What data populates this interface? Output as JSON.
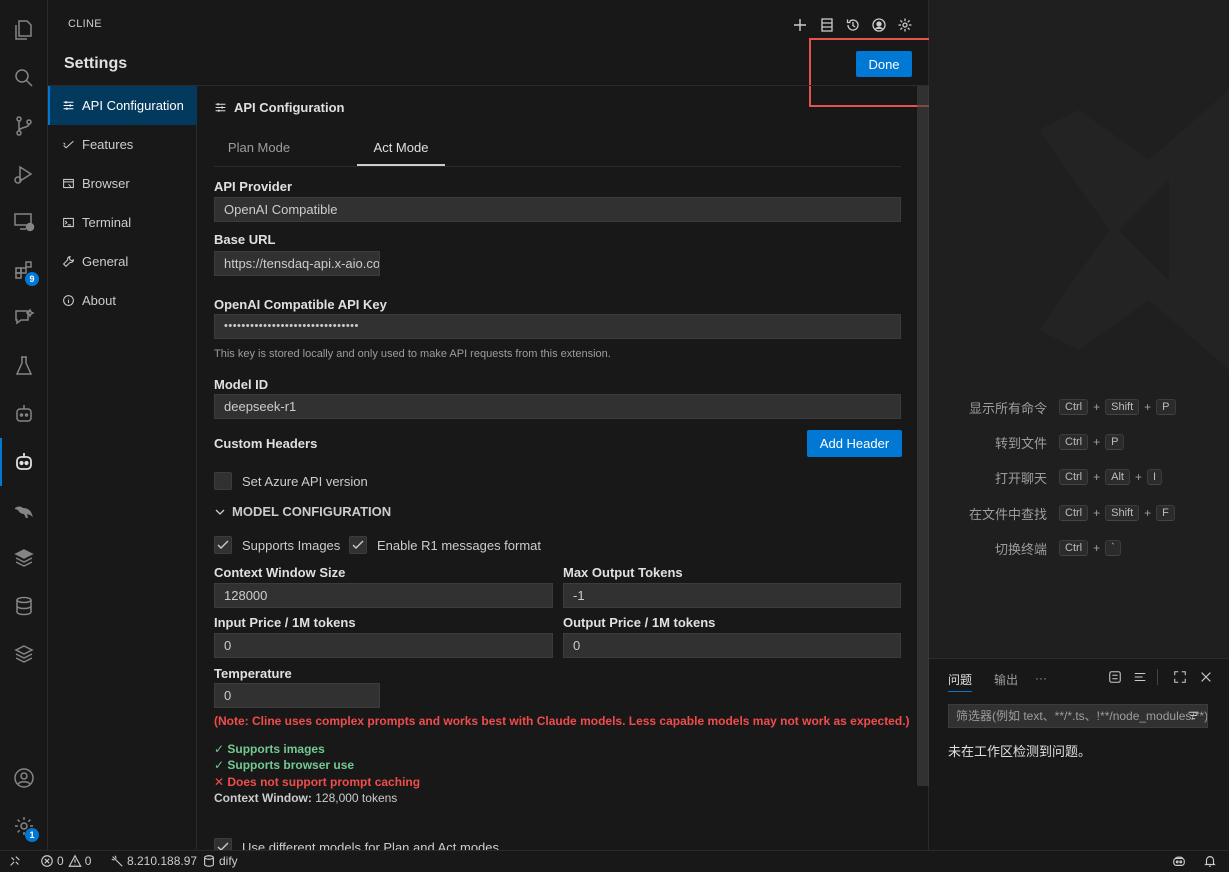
{
  "cline": {
    "title": "CLINE",
    "settings_heading": "Settings",
    "done_label": "Done"
  },
  "sidebar": {
    "items": [
      {
        "label": "API Configuration",
        "icon": "sliders-icon"
      },
      {
        "label": "Features",
        "icon": "check-icon"
      },
      {
        "label": "Browser",
        "icon": "browser-icon"
      },
      {
        "label": "Terminal",
        "icon": "terminal-icon"
      },
      {
        "label": "General",
        "icon": "wrench-icon"
      },
      {
        "label": "About",
        "icon": "info-icon"
      }
    ]
  },
  "api": {
    "section_title": "API Configuration",
    "tabs": [
      "Plan Mode",
      "Act Mode"
    ],
    "active_tab": "Act Mode",
    "provider_label": "API Provider",
    "provider_value": "OpenAI Compatible",
    "base_url_label": "Base URL",
    "base_url_value": "https://tensdaq-api.x-aio.co",
    "api_key_label": "OpenAI Compatible API Key",
    "api_key_value": "•••••••••••••••••••••••••••••••",
    "api_key_hint": "This key is stored locally and only used to make API requests from this extension.",
    "model_id_label": "Model ID",
    "model_id_value": "deepseek-r1",
    "custom_headers_label": "Custom Headers",
    "add_header_label": "Add Header",
    "azure_label": "Set Azure API version",
    "model_config_label": "MODEL CONFIGURATION",
    "supports_images_label": "Supports Images",
    "r1_format_label": "Enable R1 messages format",
    "context_window_label": "Context Window Size",
    "context_window_value": "128000",
    "max_output_label": "Max Output Tokens",
    "max_output_value": "-1",
    "input_price_label": "Input Price / 1M tokens",
    "input_price_value": "0",
    "output_price_label": "Output Price / 1M tokens",
    "output_price_value": "0",
    "temperature_label": "Temperature",
    "temperature_value": "0",
    "note": "(Note: Cline uses complex prompts and works best with Claude models. Less capable models may not work as expected.)",
    "feat_images": "Supports images",
    "feat_browser": "Supports browser use",
    "feat_cache": "Does not support prompt caching",
    "context_window_info_label": "Context Window:",
    "context_window_info_value": "128,000 tokens",
    "different_models_label": "Use different models for Plan and Act modes"
  },
  "editor": {
    "shortcuts": [
      {
        "label": "显示所有命令",
        "keys": [
          "Ctrl",
          "Shift",
          "P"
        ]
      },
      {
        "label": "转到文件",
        "keys": [
          "Ctrl",
          "P"
        ]
      },
      {
        "label": "打开聊天",
        "keys": [
          "Ctrl",
          "Alt",
          "I"
        ]
      },
      {
        "label": "在文件中查找",
        "keys": [
          "Ctrl",
          "Shift",
          "F"
        ]
      },
      {
        "label": "切换终端",
        "keys": [
          "Ctrl",
          "`"
        ]
      }
    ]
  },
  "panel": {
    "tab_problems": "问题",
    "tab_output": "输出",
    "more": "···",
    "filter_placeholder": "筛选器(例如 text、**/*.ts、!**/node_modules/**)",
    "no_problems": "未在工作区检测到问题。"
  },
  "activity": {
    "extensions_badge": "9",
    "settings_badge": "1"
  },
  "status": {
    "errors": "0",
    "warnings": "0",
    "remote": "8.210.188.97",
    "db": "dify"
  },
  "colors": {
    "accent": "#0078d4",
    "highlight": "#e5534b",
    "ok": "#73c991",
    "error": "#f14c4c"
  }
}
